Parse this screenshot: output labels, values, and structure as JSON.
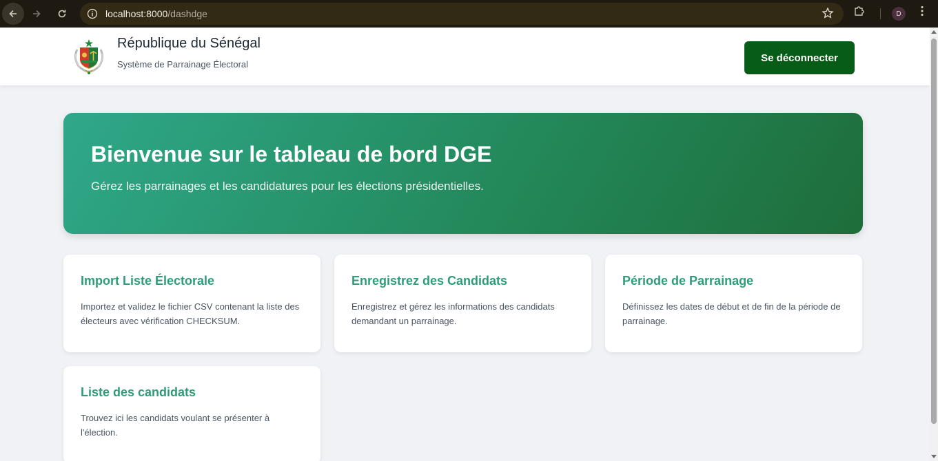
{
  "browser": {
    "url_host": "localhost:8000",
    "url_path": "/dashdge",
    "profile_initial": "D"
  },
  "header": {
    "title": "République du Sénégal",
    "subtitle": "Système de Parrainage Électoral",
    "logout_label": "Se déconnecter"
  },
  "hero": {
    "title": "Bienvenue sur le tableau de bord DGE",
    "subtitle": "Gérez les parrainages et les candidatures pour les élections présidentielles."
  },
  "cards": [
    {
      "title": "Import Liste Électorale",
      "description": "Importez et validez le fichier CSV contenant la liste des électeurs avec vérification CHECKSUM."
    },
    {
      "title": "Enregistrez des Candidats",
      "description": "Enregistrez et gérez les informations des candidats demandant un parrainage."
    },
    {
      "title": "Période de Parrainage",
      "description": "Définissez les dates de début et de fin de la période de parrainage."
    },
    {
      "title": "Liste des candidats",
      "description": "Trouvez ici les candidats voulant se présenter à l'élection."
    }
  ],
  "colors": {
    "accent": "#2f9c79",
    "logout_button": "#075d18",
    "hero_start": "#2fa88a",
    "hero_end": "#1e6d3a",
    "background": "#f0f2f5"
  },
  "icons": {
    "back": "arrow-left-icon",
    "forward": "arrow-right-icon",
    "reload": "reload-icon",
    "site_info": "info-icon",
    "bookmark": "star-icon",
    "extensions": "puzzle-icon",
    "menu": "kebab-menu-icon",
    "emblem": "coat-of-arms-icon"
  }
}
